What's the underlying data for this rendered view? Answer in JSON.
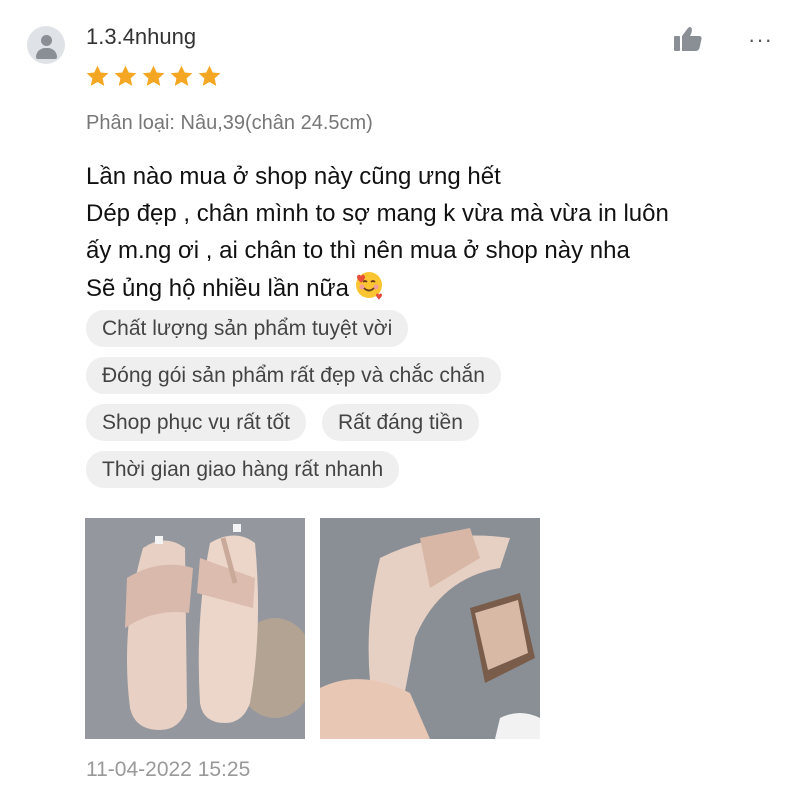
{
  "review": {
    "username": "1.3.4nhung",
    "rating": 5,
    "variant": "Phân loại: Nâu,39(chân 24.5cm)",
    "comment_lines": [
      "Lần nào mua ở shop này cũng ưng hết",
      "Dép đẹp , chân mình to sợ mang k vừa mà vừa in luôn",
      "ấy m.ng ơi , ai chân to thì nên mua ở shop này nha",
      "Sẽ ủng hộ nhiều lần nữa"
    ],
    "tags": [
      "Chất lượng sản phẩm tuyệt vời",
      "Đóng gói sản phẩm rất đẹp và chắc chắn",
      "Shop phục vụ rất tốt",
      "Rất đáng tiền",
      "Thời gian giao hàng rất nhanh"
    ],
    "timestamp": "11-04-2022 15:25",
    "more_label": "···",
    "icons": {
      "avatar": "user-avatar-icon",
      "like": "thumbs-up-icon",
      "more": "more-options-icon",
      "star": "star-icon",
      "emoji": "smiling-face-with-hearts-emoji"
    },
    "colors": {
      "star": "#f5a623",
      "tag_bg": "#efefef",
      "icon_gray": "#8a8f96"
    }
  }
}
